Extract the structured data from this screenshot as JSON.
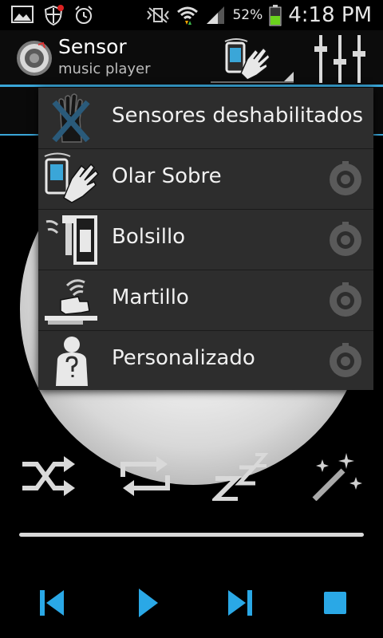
{
  "status_bar": {
    "battery_percent": "52%",
    "time": "4:18 PM",
    "icons": [
      "gallery-icon",
      "shield-icon",
      "alarm-icon",
      "vibrate-icon",
      "wifi-icon",
      "signal-icon",
      "battery-icon"
    ]
  },
  "app": {
    "title": "Sensor",
    "subtitle": "music player"
  },
  "sensor_menu": {
    "items": [
      {
        "label": "Sensores deshabilitados",
        "icon": "hand-disabled-icon",
        "has_settings": false
      },
      {
        "label": "Olar Sobre",
        "icon": "hand-over-icon",
        "has_settings": true
      },
      {
        "label": "Bolsillo",
        "icon": "pocket-icon",
        "has_settings": true
      },
      {
        "label": "Martillo",
        "icon": "hammer-icon",
        "has_settings": true
      },
      {
        "label": "Personalizado",
        "icon": "custom-person-icon",
        "has_settings": true
      }
    ]
  },
  "colors": {
    "accent": "#3aa6d8",
    "transport_blue": "#2aa8e6",
    "menu_bg": "#2d2d2d"
  },
  "controls": [
    "shuffle-icon",
    "repeat-icon",
    "sleep-icon",
    "magic-wand-icon"
  ],
  "transport": [
    "previous-icon",
    "play-icon",
    "next-icon",
    "stop-icon"
  ]
}
